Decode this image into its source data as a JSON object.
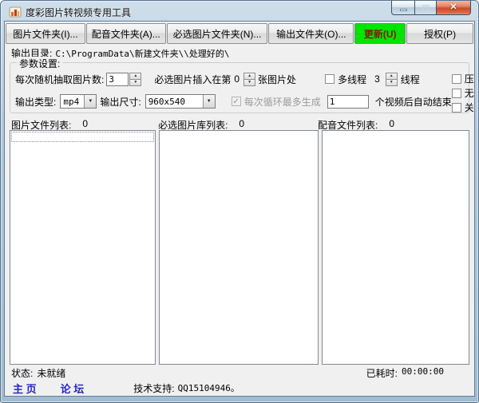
{
  "window": {
    "title": "度彩图片转视频专用工具"
  },
  "icons": {
    "close": "✕",
    "dropdown_arrow": "▼",
    "spinner_up": "▲",
    "spinner_down": "▼",
    "check": "✓"
  },
  "colors": {
    "update_button_bg": "#00e400",
    "update_button_text": "#8a1500",
    "link_blue": "#2626c9",
    "frame_blue": "#a3bccf"
  },
  "toolbar": {
    "buttons": [
      {
        "label": "图片文件夹(I)..."
      },
      {
        "label": "配音文件夹(A)..."
      },
      {
        "label": "必选图片文件夹(N)..."
      },
      {
        "label": "输出文件夹(O)..."
      },
      {
        "label": "更新(U)"
      },
      {
        "label": "授权(P)"
      }
    ]
  },
  "output_dir": {
    "label": "输出目录:",
    "path": "C:\\ProgramData\\新建文件夹\\\\处理好的\\"
  },
  "params": {
    "group_title": "参数设置:",
    "row1": {
      "pick_label": "每次随机抽取图片数:",
      "pick_value": "3",
      "insert_label_pre": "必选图片插入在第",
      "insert_value": "0",
      "insert_label_post": "张图片处",
      "multithread_label": "多线程",
      "thread_count": "3",
      "thread_label": "线程"
    },
    "row2": {
      "type_label": "输出类型:",
      "type_value": "mp4",
      "size_label": "输出尺寸:",
      "size_value": "960x540",
      "loop_label": "每次循环最多生成",
      "loop_value": "1",
      "loop_label_post": "个视频后自动结束"
    },
    "checkboxes_right": [
      {
        "label": "压缩视频"
      },
      {
        "label": "无黑边缩放"
      },
      {
        "label": "关机"
      }
    ]
  },
  "lists": [
    {
      "label": "图片文件列表:",
      "count": "0"
    },
    {
      "label": "必选图片库列表:",
      "count": "0"
    },
    {
      "label": "配音文件列表:",
      "count": "0"
    }
  ],
  "statusbar": {
    "status_label": "状态:",
    "status_value": "未就绪",
    "elapsed_label": "已耗时:",
    "elapsed_value": "00:00:00",
    "home_link": "主 页",
    "forum_link": "论 坛",
    "support_label": "技术支持:",
    "support_value": "QQ15104946。"
  }
}
